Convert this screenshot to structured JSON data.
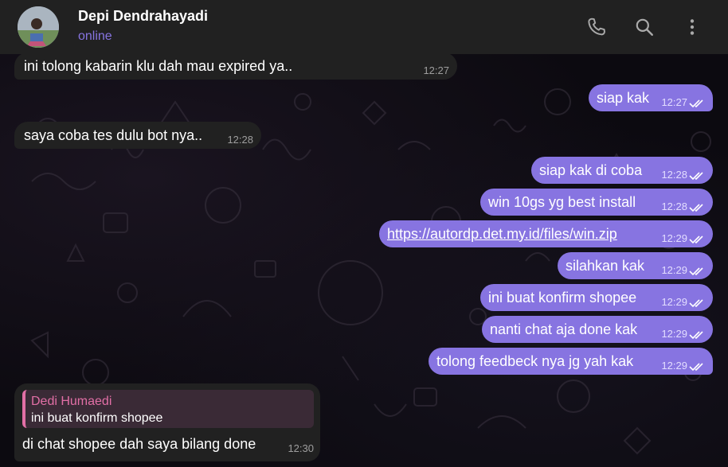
{
  "header": {
    "contact_name": "Depi Dendrahayadi",
    "status": "online",
    "icons": [
      "phone-icon",
      "search-icon",
      "more-vertical-icon"
    ]
  },
  "colors": {
    "header_bg": "#212121",
    "incoming_bubble": "#212121",
    "outgoing_bubble": "#8774e1",
    "status_accent": "#8774e1",
    "reply_accent": "#e26fa6"
  },
  "messages": [
    {
      "direction": "in",
      "text": "ini tolong kabarin klu dah mau expired ya..",
      "time": "12:27"
    },
    {
      "direction": "out",
      "text": "siap kak",
      "time": "12:27",
      "read": true
    },
    {
      "direction": "in",
      "text": "saya coba tes dulu bot nya..",
      "time": "12:28"
    },
    {
      "direction": "out",
      "text": "siap kak di coba",
      "time": "12:28",
      "read": true
    },
    {
      "direction": "out",
      "text": "win 10gs yg best install",
      "time": "12:28",
      "read": true
    },
    {
      "direction": "out",
      "text": "https://autordp.det.my.id/files/win.zip",
      "time": "12:29",
      "read": true,
      "is_link": true
    },
    {
      "direction": "out",
      "text": "silahkan kak",
      "time": "12:29",
      "read": true
    },
    {
      "direction": "out",
      "text": "ini buat konfirm shopee",
      "time": "12:29",
      "read": true
    },
    {
      "direction": "out",
      "text": "nanti chat aja done kak",
      "time": "12:29",
      "read": true
    },
    {
      "direction": "out",
      "text": "tolong feedbeck nya jg yah kak",
      "time": "12:29",
      "read": true
    }
  ],
  "reply_message": {
    "quoted_author": "Dedi Humaedi",
    "quoted_text": "ini buat konfirm shopee",
    "text": "di chat shopee dah saya bilang done",
    "time": "12:30"
  }
}
